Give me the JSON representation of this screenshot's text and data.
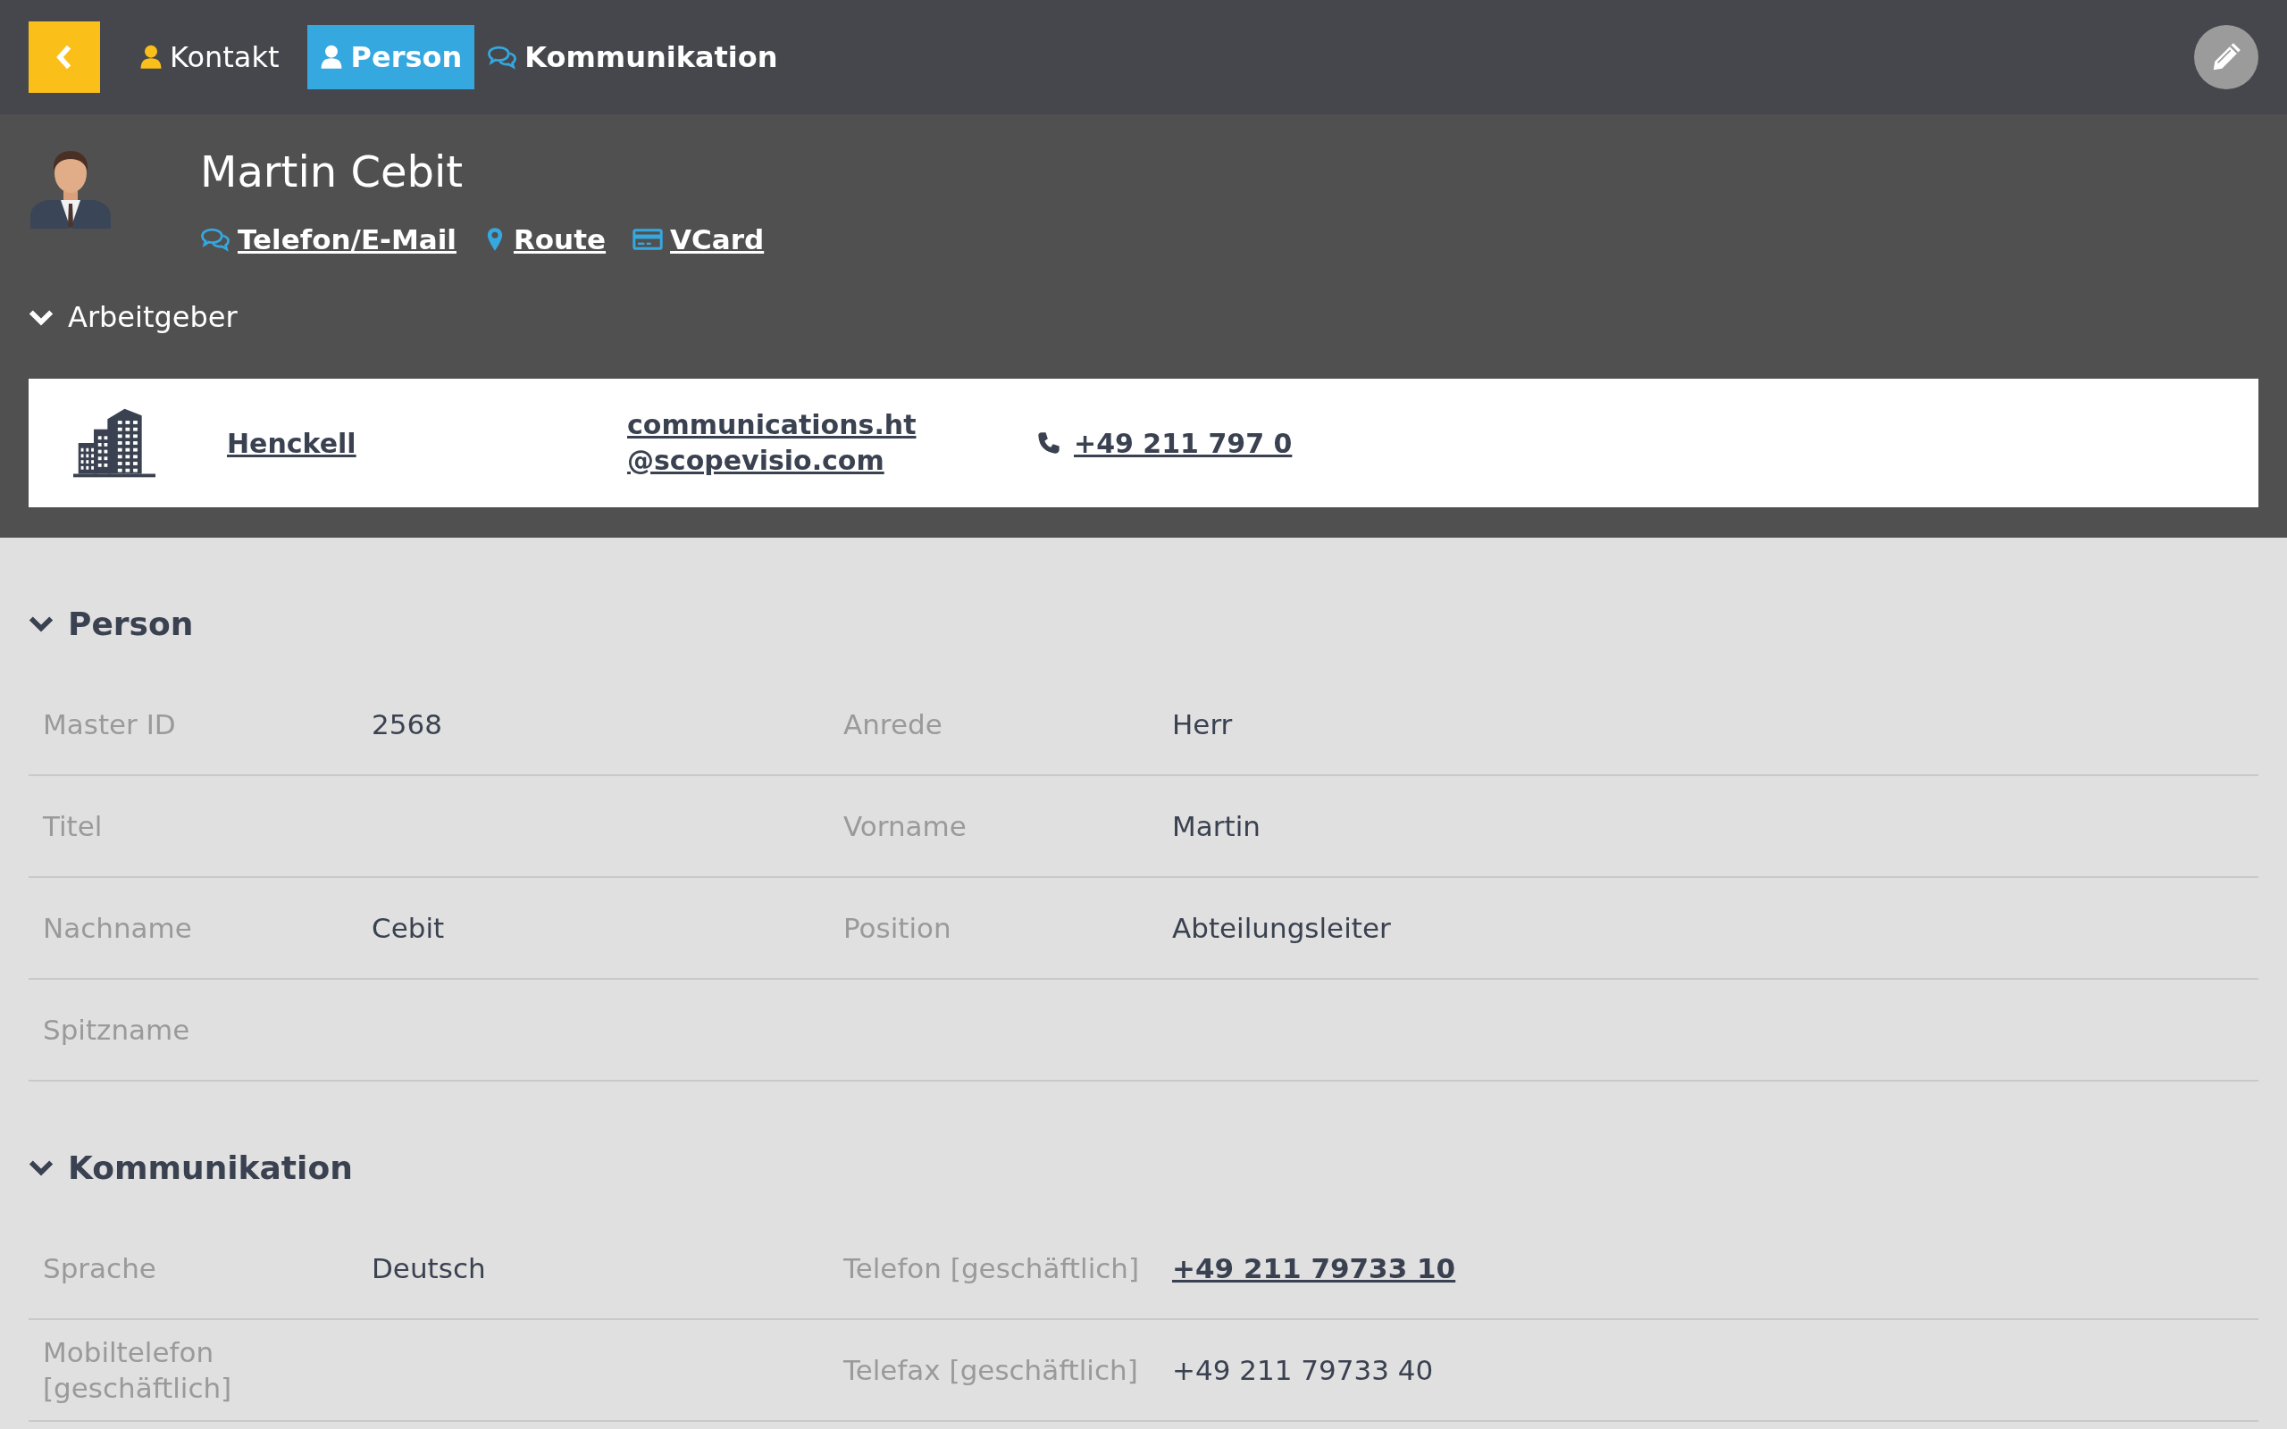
{
  "breadcrumb": {
    "label": "Kontakt"
  },
  "tabs": [
    {
      "label": "Person",
      "kind": "person",
      "selected": true
    },
    {
      "label": "Kommunikation",
      "kind": "chat",
      "selected": false
    }
  ],
  "contact": {
    "name": "Martin Cebit",
    "links": [
      {
        "label": "Telefon/E-Mail",
        "kind": "chat"
      },
      {
        "label": "Route",
        "kind": "pin"
      },
      {
        "label": "VCard",
        "kind": "card"
      }
    ]
  },
  "employer_section": {
    "title": "Arbeitgeber",
    "expanded": true,
    "employer": {
      "name": "Henckell",
      "email": "communications.ht@scopevisio.com",
      "phone": "+49 211 797 0"
    }
  },
  "sections": [
    {
      "title": "Person",
      "expanded": true,
      "rows": [
        [
          {
            "label": "Master ID",
            "value": "2568",
            "kind": "text"
          },
          {
            "label": "Anrede",
            "value": "Herr",
            "kind": "text"
          }
        ],
        [
          {
            "label": "Titel"
          },
          {
            "label": "Vorname",
            "value": "Martin",
            "kind": "text"
          }
        ],
        [
          {
            "label": "Nachname",
            "value": "Cebit",
            "kind": "text"
          },
          {
            "label": "Position",
            "value": "Abteilungsleiter",
            "kind": "text"
          }
        ],
        [
          {
            "label": "Spitzname"
          }
        ]
      ]
    },
    {
      "title": "Kommunikation",
      "expanded": true,
      "rows": [
        [
          {
            "label": "Sprache",
            "value": "Deutsch",
            "kind": "text"
          },
          {
            "label": "Telefon [geschäftlich]",
            "value": "+49 211 79733 10",
            "kind": "link"
          }
        ],
        [
          {
            "label": "Mobiltelefon [geschäftlich]"
          },
          {
            "label": "Telefax [geschäftlich]",
            "value": "+49 211 79733 40",
            "kind": "text"
          }
        ]
      ]
    }
  ]
}
